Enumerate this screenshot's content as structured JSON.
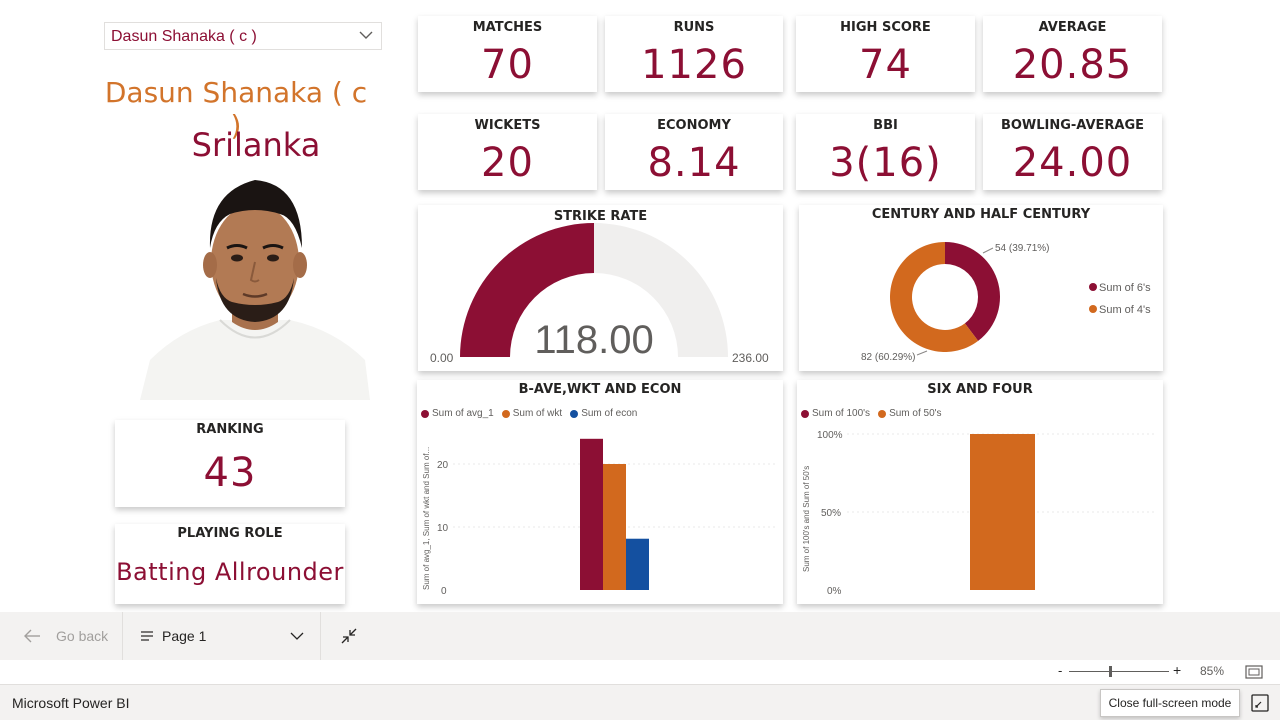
{
  "slicer": {
    "selected": "Dasun Shanaka ( c )"
  },
  "player": {
    "name": "Dasun Shanaka ( c )",
    "country": "Srilanka"
  },
  "kpis": [
    {
      "title": "MATCHES",
      "value": "70"
    },
    {
      "title": "RUNS",
      "value": "1126"
    },
    {
      "title": "HIGH SCORE",
      "value": "74"
    },
    {
      "title": "AVERAGE",
      "value": "20.85"
    },
    {
      "title": "WICKETS",
      "value": "20"
    },
    {
      "title": "ECONOMY",
      "value": "8.14"
    },
    {
      "title": "BBI",
      "value": "3(16)"
    },
    {
      "title": "BOWLING-AVERAGE",
      "value": "24.00"
    }
  ],
  "ranking": {
    "title": "RANKING",
    "value": "43"
  },
  "role": {
    "title": "PLAYING ROLE",
    "value": "Batting Allrounder"
  },
  "colors": {
    "maroon": "#8c0f34",
    "orange": "#d2691e",
    "blue": "#1450a0",
    "gauge_bg": "#f0efee"
  },
  "chart_data": [
    {
      "type": "gauge",
      "title": "STRIKE RATE",
      "value": 118.0,
      "value_label": "118.00",
      "min": 0,
      "max": 236,
      "min_label": "0.00",
      "max_label": "236.00"
    },
    {
      "type": "pie",
      "title": "CENTURY AND HALF CENTURY",
      "legend_position": "right",
      "slices": [
        {
          "name": "Sum of 6's",
          "value": 54,
          "label": "54 (39.71%)",
          "color": "#8c0f34"
        },
        {
          "name": "Sum of 4's",
          "value": 82,
          "label": "82 (60.29%)",
          "color": "#d2691e"
        }
      ]
    },
    {
      "type": "bar",
      "title": "B-AVE,WKT AND ECON",
      "ylabel": "Sum of avg_1, Sum of wkt and Sum of...",
      "ylim": [
        0,
        25
      ],
      "yticks": [
        "0",
        "10",
        "20"
      ],
      "legend_position": "top-left",
      "series": [
        {
          "name": "Sum of avg_1",
          "values": [
            24.0
          ],
          "color": "#8c0f34"
        },
        {
          "name": "Sum of wkt",
          "values": [
            20
          ],
          "color": "#d2691e"
        },
        {
          "name": "Sum of econ",
          "values": [
            8.14
          ],
          "color": "#1450a0"
        }
      ]
    },
    {
      "type": "bar",
      "title": "SIX AND FOUR",
      "ylabel": "Sum of 100's and Sum of 50's",
      "ylim": [
        0,
        100
      ],
      "yticks": [
        "0%",
        "50%",
        "100%"
      ],
      "legend_position": "top-left",
      "stacked_percent": true,
      "series": [
        {
          "name": "Sum of 100's",
          "values": [
            0
          ],
          "color": "#8c0f34"
        },
        {
          "name": "Sum of 50's",
          "values": [
            100
          ],
          "color": "#d2691e"
        }
      ]
    }
  ],
  "bottom_bar": {
    "go_back": "Go back",
    "page": "Page 1"
  },
  "zoom": {
    "level": "85%",
    "minus": "-",
    "plus": "+"
  },
  "status": {
    "app": "Microsoft Power BI",
    "tooltip": "Close full-screen mode"
  }
}
